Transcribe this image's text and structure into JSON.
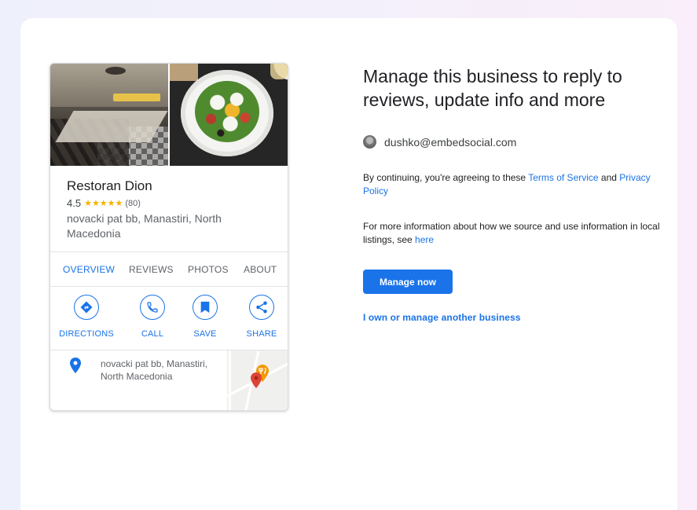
{
  "card": {
    "business_name": "Restoran Dion",
    "rating": "4.5",
    "stars": "★★★★★",
    "review_count": "(80)",
    "address": "novacki pat bb, Manastiri, North Macedonia",
    "tabs": [
      {
        "label": "OVERVIEW",
        "active": true
      },
      {
        "label": "REVIEWS",
        "active": false
      },
      {
        "label": "PHOTOS",
        "active": false
      },
      {
        "label": "ABOUT",
        "active": false
      }
    ],
    "actions": [
      {
        "label": "DIRECTIONS",
        "icon": "directions-icon"
      },
      {
        "label": "CALL",
        "icon": "phone-icon"
      },
      {
        "label": "SAVE",
        "icon": "bookmark-icon"
      },
      {
        "label": "SHARE",
        "icon": "share-icon"
      }
    ],
    "location_text": "novacki pat bb, Manastiri, North Macedonia"
  },
  "right": {
    "headline": "Manage this business to reply to reviews, update info and more",
    "account_email": "dushko@embedsocial.com",
    "consent_prefix": "By continuing, you're agreeing to these ",
    "terms_link": "Terms of Service",
    "consent_and": " and ",
    "privacy_link": "Privacy Policy",
    "info_prefix": "For more information about how we source and use information in local listings, see ",
    "info_link": "here",
    "manage_button": "Manage now",
    "other_business_link": "I own or manage another business"
  },
  "colors": {
    "accent": "#1a73e8",
    "star": "#f4b400",
    "map_pin": "#db4437",
    "restaurant_pin": "#f29900"
  }
}
